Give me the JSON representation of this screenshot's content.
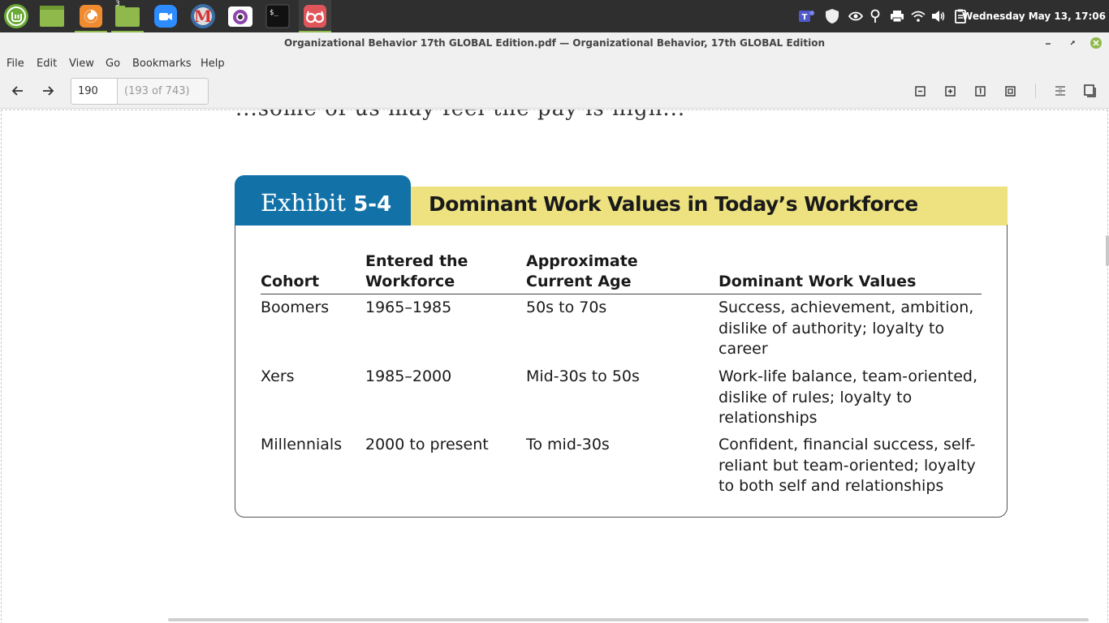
{
  "taskbar": {
    "launchers": [
      {
        "name": "mint-menu-icon",
        "color": "#6aaa35"
      },
      {
        "name": "files-icon",
        "color": "#8fb94a"
      },
      {
        "name": "firefox-icon",
        "color": "#f08b30"
      },
      {
        "name": "folder-icon",
        "color": "#8fb94a",
        "badge": "3"
      },
      {
        "name": "zoom-icon",
        "color": "#2d8cff"
      },
      {
        "name": "m-app-icon",
        "color": "#d43333"
      },
      {
        "name": "camera-icon",
        "color": "#8e44ad"
      },
      {
        "name": "terminal-icon",
        "color": "#1a1a1a"
      },
      {
        "name": "reader-icon",
        "color": "#e0555a"
      }
    ],
    "tray_icons": [
      "teams-icon",
      "shield-icon",
      "nvidia-icon",
      "location-icon",
      "printer-icon",
      "wifi-icon",
      "volume-icon",
      "clipboard-icon"
    ],
    "clock": "Wednesday May 13, 17:06"
  },
  "window": {
    "title": "Organizational Behavior 17th GLOBAL Edition.pdf — Organizational Behavior, 17th GLOBAL Edition"
  },
  "menu": {
    "items": [
      "File",
      "Edit",
      "View",
      "Go",
      "Bookmarks",
      "Help"
    ]
  },
  "toolbar": {
    "page_value": "190",
    "page_count": "(193 of 743)"
  },
  "document": {
    "cut_text": "...some of us may feel the pay is high...",
    "exhibit": {
      "label_prefix": "Exhibit ",
      "label_number": "5-4",
      "title": "Dominant Work Values in Today’s Workforce",
      "headers": [
        {
          "line1": "",
          "line2": "Cohort"
        },
        {
          "line1": "Entered the",
          "line2": "Workforce"
        },
        {
          "line1": "Approximate",
          "line2": "Current Age"
        },
        {
          "line1": "",
          "line2": "Dominant Work Values"
        }
      ],
      "rows": [
        {
          "cohort": "Boomers",
          "entered": "1965–1985",
          "age": "50s to 70s",
          "values": [
            "Success, achievement, ambition,",
            "dislike of authority; loyalty to",
            "career"
          ]
        },
        {
          "cohort": "Xers",
          "entered": "1985–2000",
          "age": "Mid-30s to 50s",
          "values": [
            "Work-life balance, team-oriented,",
            "dislike of rules; loyalty to",
            "relationships"
          ]
        },
        {
          "cohort": "Millennials",
          "entered": "2000 to present",
          "age": "To mid-30s",
          "values": [
            "Confident, financial success, self-",
            "reliant but team-oriented; loyalty",
            "to both self and relationships"
          ]
        }
      ]
    }
  },
  "colors": {
    "exhibit_blue": "#1272a8",
    "exhibit_yellow": "#ede27f"
  }
}
